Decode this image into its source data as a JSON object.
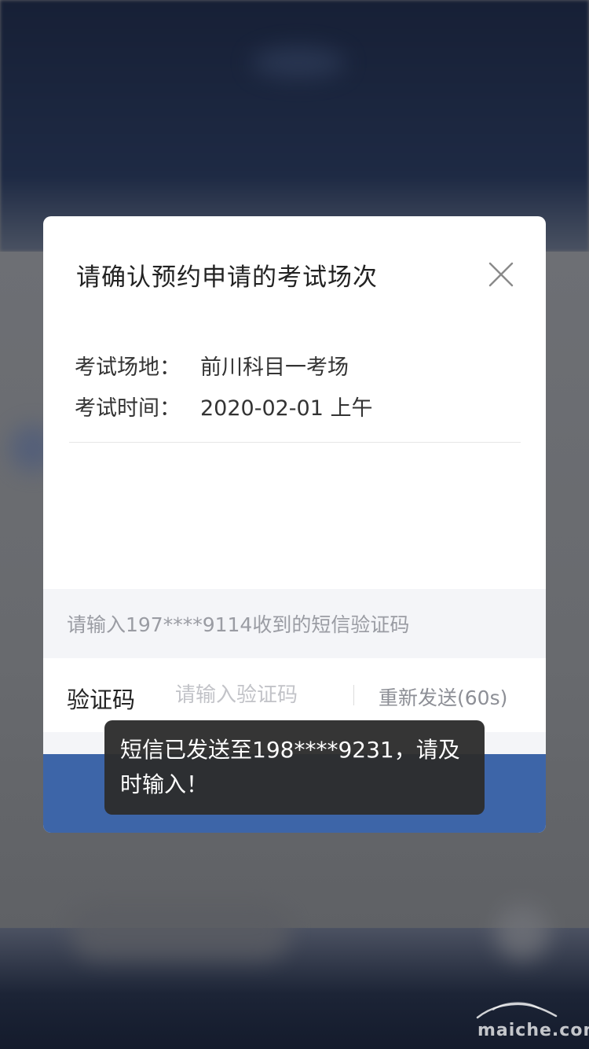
{
  "modal": {
    "title": "请确认预约申请的考试场次",
    "venue_label": "考试场地：",
    "venue_value": "前川科目一考场",
    "time_label": "考试时间：",
    "time_value": "2020-02-01 上午",
    "sms_hint": "请输入197****9114收到的短信验证码",
    "code_label": "验证码",
    "code_placeholder": "请输入验证码",
    "code_value": "",
    "resend_label": "重新发送(60s)",
    "confirm_label": ""
  },
  "toast": {
    "message": "短信已发送至198****9231，请及时输入！"
  },
  "watermark": {
    "text": "maiche.com"
  },
  "colors": {
    "accent": "#3d65a8",
    "toast_bg": "#2d2d2d",
    "hint_bg": "#f4f5f8"
  },
  "icons": {
    "close": "close-icon",
    "watermark_logo": "car-logo-icon"
  }
}
